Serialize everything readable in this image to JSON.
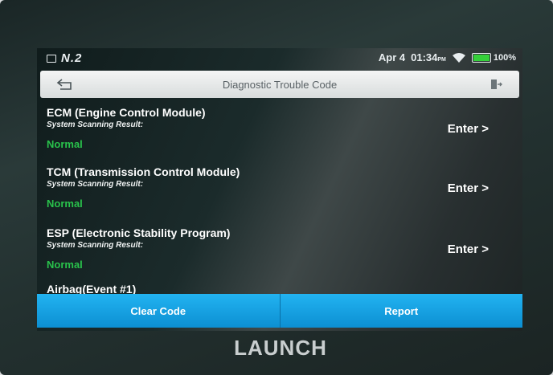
{
  "statusbar": {
    "version": "N.2",
    "date": "Apr 4",
    "time": "01:34",
    "ampm": "PM",
    "battery_pct": "100%",
    "battery_level": 1.0
  },
  "header": {
    "title": "Diagnostic Trouble Code"
  },
  "systems": [
    {
      "name": "ECM (Engine Control Module)",
      "subtitle": "System Scanning Result:",
      "result": "Normal",
      "action": "Enter >"
    },
    {
      "name": "TCM (Transmission Control Module)",
      "subtitle": "System Scanning Result:",
      "result": "Normal",
      "action": "Enter >"
    },
    {
      "name": "ESP (Electronic Stability Program)",
      "subtitle": "System Scanning Result:",
      "result": "Normal",
      "action": "Enter >"
    },
    {
      "name": "Airbag(Event #1)"
    }
  ],
  "buttons": {
    "clear_code": "Clear Code",
    "report": "Report"
  },
  "brand": "LAUNCH",
  "colors": {
    "normal": "#29c24b",
    "accent": "#16a3e4",
    "battery": "#35d13a"
  }
}
